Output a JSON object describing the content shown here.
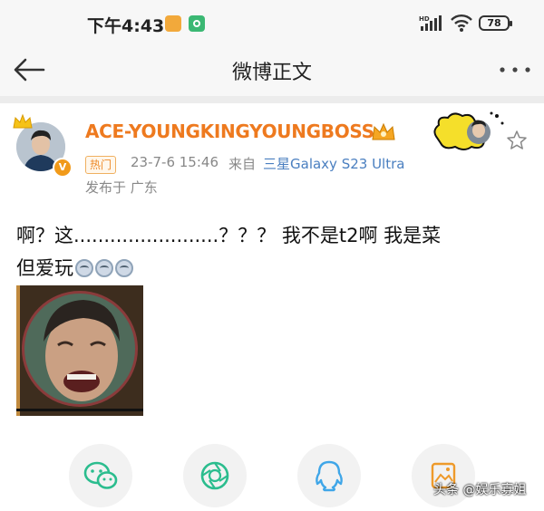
{
  "status_bar": {
    "time": "下午4:43",
    "battery": "78",
    "network_label": "HD"
  },
  "nav": {
    "title": "微博正文"
  },
  "post": {
    "username": "ACE-YOUNGKINGYOUNGBOSS",
    "hot_tag": "热门",
    "timestamp": "23-7-6 15:46",
    "from_label": "来自",
    "device": "三星Galaxy S23 Ultra",
    "location": "发布于 广东",
    "text_line1": "啊？这........................？？？ 我不是t2啊 我是菜",
    "text_line2": "但爱玩"
  },
  "share": {
    "wechat": "wechat-icon",
    "moments": "moments-icon",
    "qq": "qq-icon",
    "save": "save-image-icon"
  },
  "watermark": "头条 @娱乐寡姐",
  "colors": {
    "username": "#ee7a1f",
    "device_link": "#4a7fc0",
    "share_icon": "#2bbd8e",
    "qq_icon": "#3fa6e8"
  }
}
